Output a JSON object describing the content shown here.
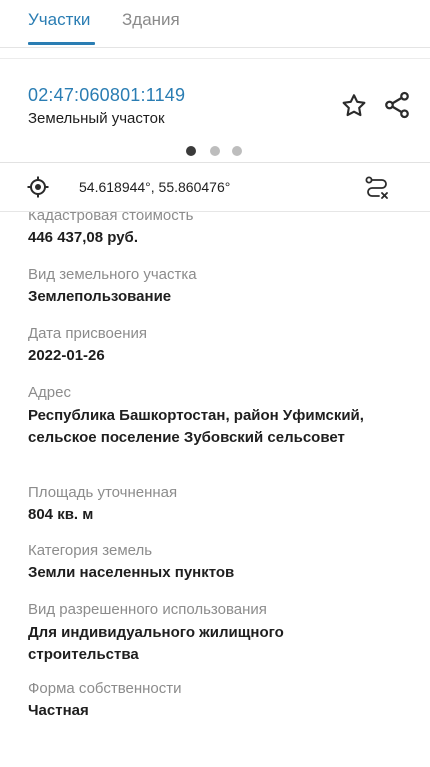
{
  "tabs": [
    {
      "label": "Участки",
      "active": true
    },
    {
      "label": "Здания",
      "active": false
    }
  ],
  "card": {
    "cadastral_number": "02:47:060801:1149",
    "object_type": "Земельный участок",
    "pager": {
      "count": 3,
      "active_index": 0
    }
  },
  "coords": {
    "text": "54.618944°, 55.860476°"
  },
  "icons": {
    "star": "star-outline-icon",
    "share": "share-icon",
    "locate": "crosshair-icon",
    "route": "route-icon"
  },
  "colors": {
    "accent": "#2a7db3",
    "label": "#8c8c8c",
    "text": "#1e1e1e"
  },
  "properties": [
    {
      "label": "Кадастровая стоимость",
      "value": "446 437,08 руб."
    },
    {
      "label": "Вид земельного участка",
      "value": "Землепользование"
    },
    {
      "label": "Дата присвоения",
      "value": "2022-01-26"
    },
    {
      "label": "Адрес",
      "value": "Республика Башкортостан, район Уфимский, сельское поселение Зубовский сельсовет"
    },
    {
      "label": "Площадь уточненная",
      "value": "804 кв. м"
    },
    {
      "label": "Категория земель",
      "value": "Земли населенных пунктов"
    },
    {
      "label": "Вид разрешенного использования",
      "value": "Для индивидуального жилищного строительства"
    },
    {
      "label": "Форма собственности",
      "value": "Частная"
    }
  ]
}
